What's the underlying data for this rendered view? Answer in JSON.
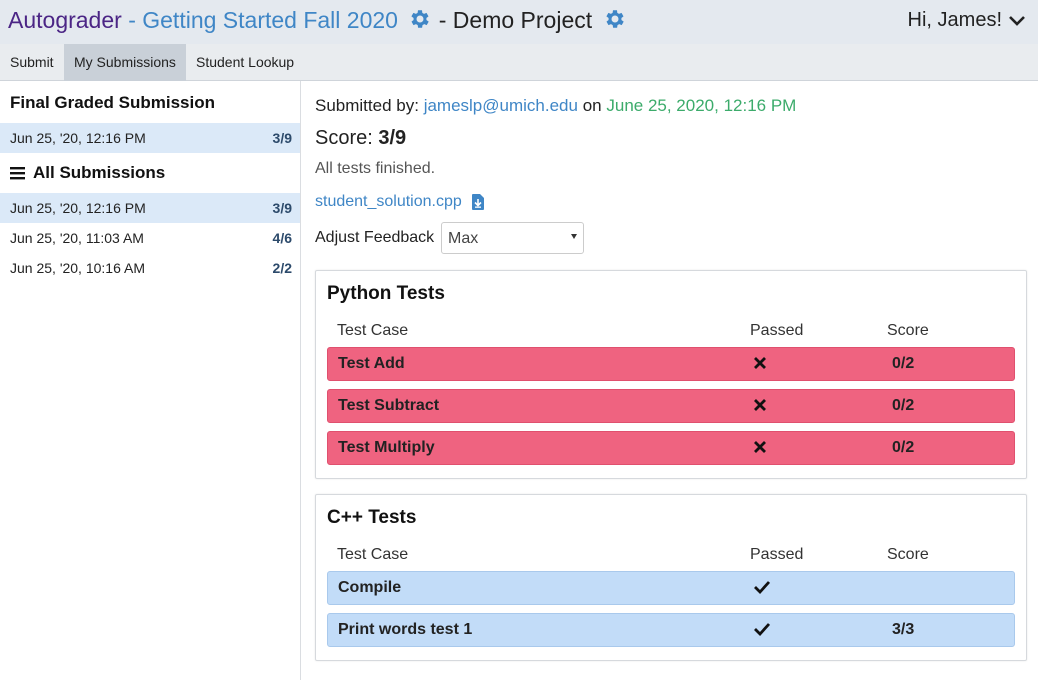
{
  "header": {
    "app_title": "Autograder",
    "course_title": "- Getting Started Fall 2020",
    "project_title": "- Demo Project",
    "user_greeting": "Hi, James!",
    "gear_color": "#3f86c6"
  },
  "tabs": [
    {
      "label": "Submit",
      "active": false
    },
    {
      "label": "My Submissions",
      "active": true
    },
    {
      "label": "Student Lookup",
      "active": false
    }
  ],
  "sidebar": {
    "final_heading": "Final Graded Submission",
    "final_submission": {
      "date": "Jun 25, '20, 12:16 PM",
      "score": "3/9"
    },
    "all_heading": "All Submissions",
    "submissions": [
      {
        "date": "Jun 25, '20, 12:16 PM",
        "score": "3/9",
        "selected": true
      },
      {
        "date": "Jun 25, '20, 11:03 AM",
        "score": "4/6",
        "selected": false
      },
      {
        "date": "Jun 25, '20, 10:16 AM",
        "score": "2/2",
        "selected": false
      }
    ]
  },
  "submission": {
    "submitted_by_label": "Submitted by:",
    "submitter": "jameslp@umich.edu",
    "on_label": "on",
    "submitted_at": "June 25, 2020, 12:16 PM",
    "score_label": "Score:",
    "score": "3/9",
    "status": "All tests finished.",
    "file_name": "student_solution.cpp",
    "adjust_feedback_label": "Adjust Feedback",
    "feedback_selected": "Max"
  },
  "suites": [
    {
      "name": "Python Tests",
      "col_test_case": "Test Case",
      "col_passed": "Passed",
      "col_score": "Score",
      "tests": [
        {
          "name": "Test Add",
          "passed": false,
          "mark_icon": "x-icon",
          "score": "0/2"
        },
        {
          "name": "Test Subtract",
          "passed": false,
          "mark_icon": "x-icon",
          "score": "0/2"
        },
        {
          "name": "Test Multiply",
          "passed": false,
          "mark_icon": "x-icon",
          "score": "0/2"
        }
      ]
    },
    {
      "name": "C++ Tests",
      "col_test_case": "Test Case",
      "col_passed": "Passed",
      "col_score": "Score",
      "tests": [
        {
          "name": "Compile",
          "passed": true,
          "mark_icon": "check-icon",
          "score": ""
        },
        {
          "name": "Print words test 1",
          "passed": true,
          "mark_icon": "check-icon",
          "score": "3/3"
        }
      ]
    }
  ],
  "colors": {
    "fail_row": "#ef6380",
    "pass_row": "#c2dcf8",
    "link": "#3f86c6",
    "date": "#3cab6b",
    "app_title": "#4b2585"
  }
}
